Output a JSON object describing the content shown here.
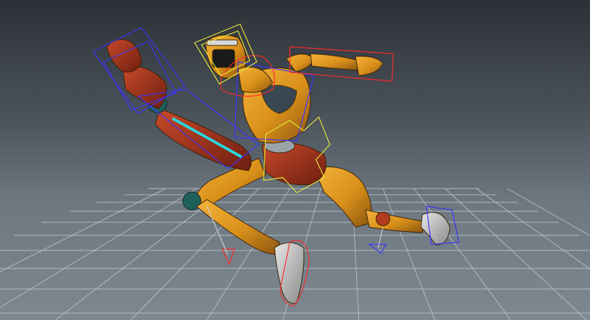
{
  "viewport": {
    "kind": "3d-perspective-viewport",
    "grid": true
  },
  "character": {
    "name": "",
    "body_color": "#e09a1a",
    "accent_color": "#b33a1c",
    "glow_color": "#28d8e0"
  },
  "rig": {
    "fk_control_color": "#3a34ff",
    "ik_control_color": "#ff2a2a",
    "head_control_color": "#e6e63a"
  }
}
